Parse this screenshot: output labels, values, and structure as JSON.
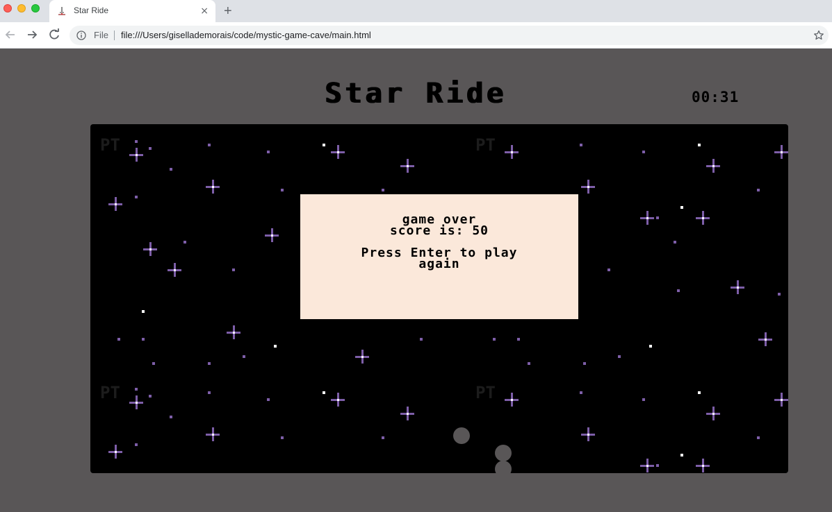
{
  "browser": {
    "tab_title": "Star Ride",
    "new_tab_label": "+",
    "close_tab_label": "×",
    "scheme_label": "File",
    "url": "file:///Users/gisellademorais/code/mystic-game-cave/main.html"
  },
  "game": {
    "title": "Star Ride",
    "timer": "00:31",
    "watermark": "PT",
    "overlay": {
      "line1": "game over",
      "line2": "score is: 50",
      "line3": "Press Enter to play",
      "line4": "again"
    }
  },
  "colors": {
    "page_background": "#595657",
    "canvas_background": "#000000",
    "overlay_background": "#fbe8da",
    "star_purple": "#7d5ea8",
    "star_white": "#ffffff",
    "player_gray": "#595657"
  }
}
